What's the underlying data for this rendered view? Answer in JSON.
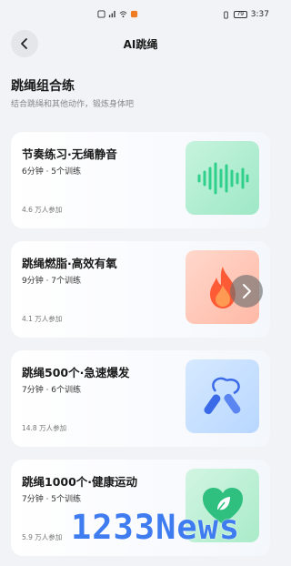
{
  "status_bar": {
    "time": "3:37",
    "battery": "79"
  },
  "header": {
    "title": "AI跳绳"
  },
  "section": {
    "title": "跳绳组合练",
    "subtitle": "结合跳绳和其他动作，锻炼身体吧"
  },
  "cards": [
    {
      "title": "节奏练习·无绳静音",
      "meta": "6分钟 · 5个训练",
      "count": "4.6 万人参加",
      "icon": "sound-wave-icon"
    },
    {
      "title": "跳绳燃脂·高效有氧",
      "meta": "9分钟 · 7个训练",
      "count": "4.1 万人参加",
      "icon": "fire-icon"
    },
    {
      "title": "跳绳500个·急速爆发",
      "meta": "7分钟 · 6个训练",
      "count": "14.8 万人参加",
      "icon": "jump-rope-icon"
    },
    {
      "title": "跳绳1000个·健康运动",
      "meta": "7分钟 · 5个训练",
      "count": "5.9 万人参加",
      "icon": "heart-leaf-icon"
    }
  ],
  "watermark": "1233News"
}
